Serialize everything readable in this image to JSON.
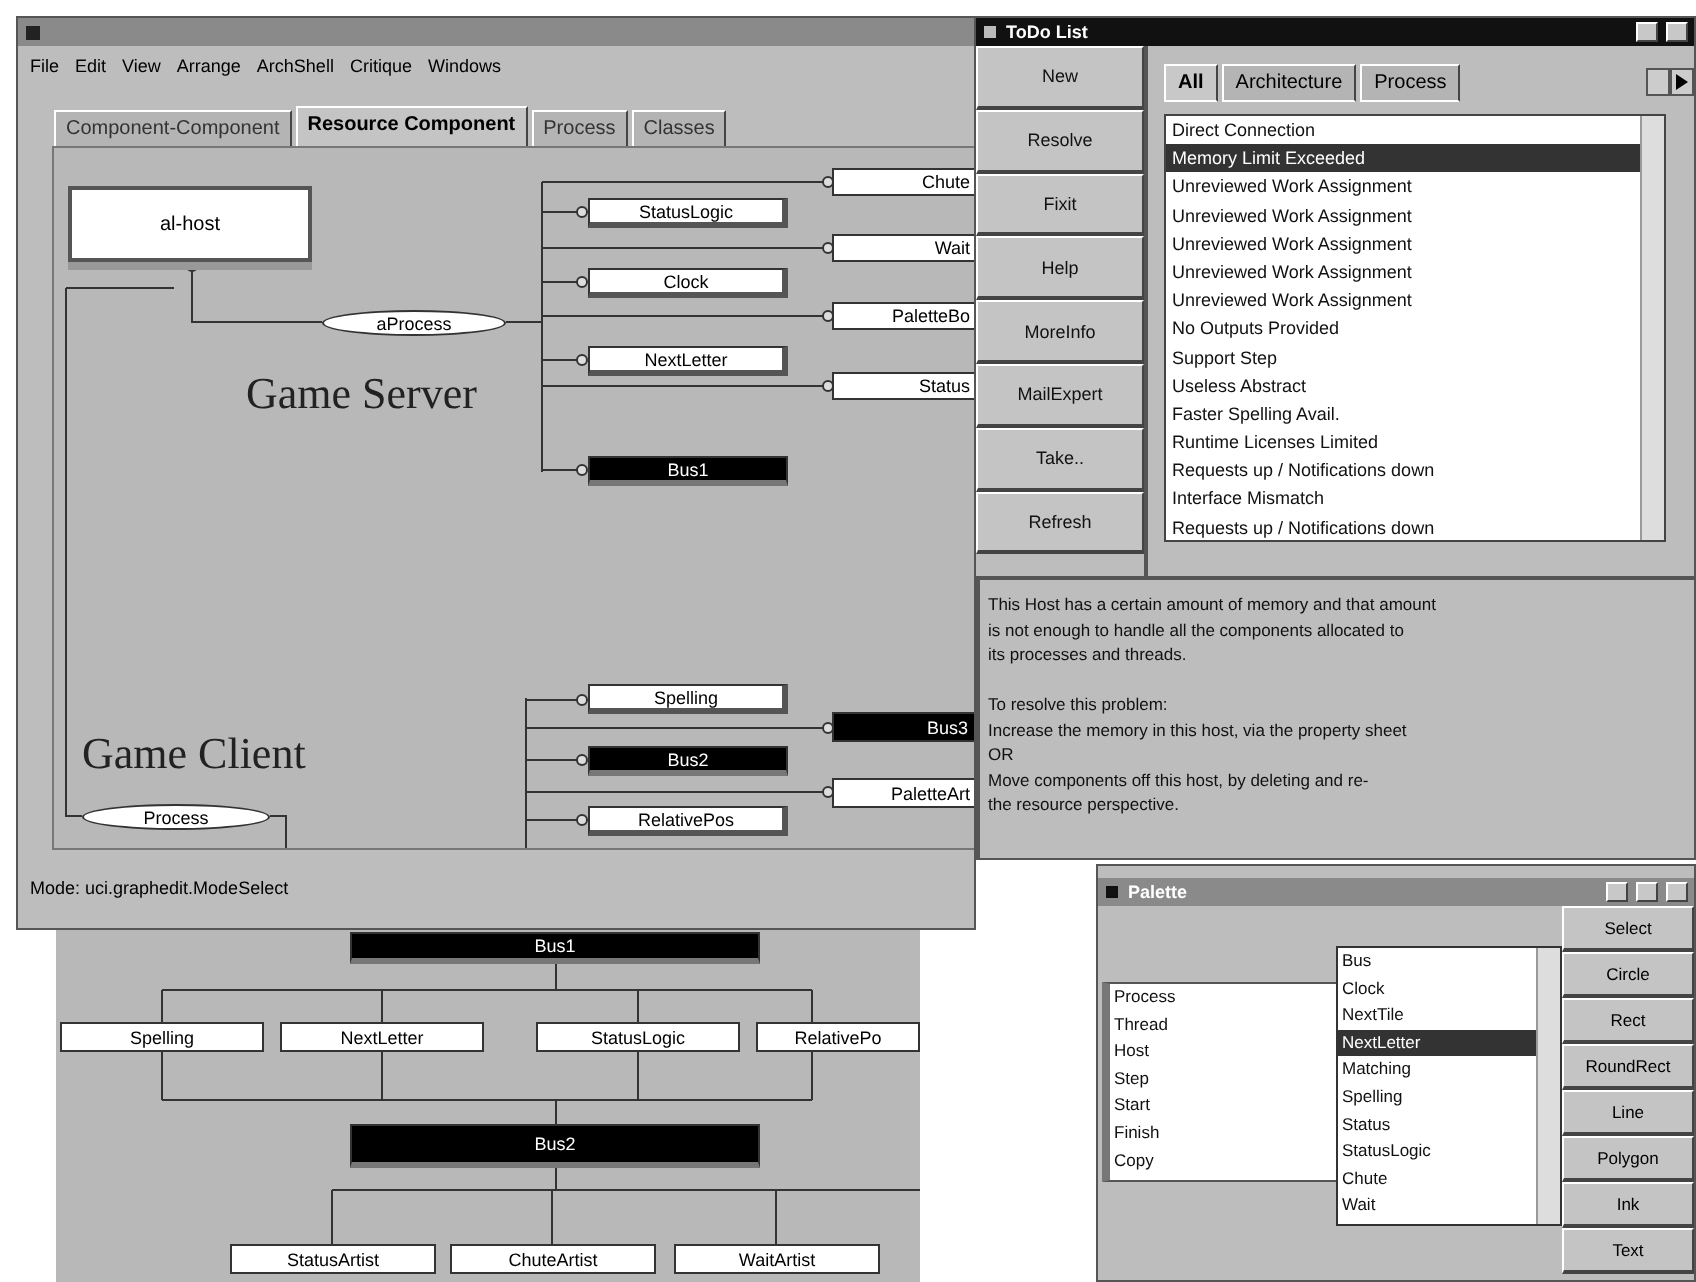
{
  "main_window": {
    "menu": [
      "File",
      "Edit",
      "View",
      "Arrange",
      "ArchShell",
      "Critique",
      "Windows"
    ],
    "tabs": [
      {
        "label": "Component-Component",
        "selected": false
      },
      {
        "label": "Resource Component",
        "selected": true
      },
      {
        "label": "Process",
        "selected": false
      },
      {
        "label": "Classes",
        "selected": false
      }
    ],
    "diagram": {
      "labels": [
        "Game Server",
        "Game Client"
      ],
      "nodes": [
        {
          "text": "al-host",
          "kind": "host"
        },
        {
          "text": "aProcess",
          "kind": "process"
        },
        {
          "text": "StatusLogic",
          "kind": "component"
        },
        {
          "text": "Clock",
          "kind": "component"
        },
        {
          "text": "NextLetter",
          "kind": "component"
        },
        {
          "text": "Bus1",
          "kind": "bus"
        },
        {
          "text": "Chute",
          "kind": "stub"
        },
        {
          "text": "Wait",
          "kind": "stub"
        },
        {
          "text": "PaletteBo",
          "kind": "stub"
        },
        {
          "text": "Status",
          "kind": "stub"
        },
        {
          "text": "Spelling",
          "kind": "component"
        },
        {
          "text": "Bus2",
          "kind": "bus"
        },
        {
          "text": "RelativePos",
          "kind": "component"
        },
        {
          "text": "Bus3",
          "kind": "busstub"
        },
        {
          "text": "PaletteArt",
          "kind": "stub"
        },
        {
          "text": "Process",
          "kind": "process"
        }
      ]
    },
    "status_bar": "Mode: uci.graphedit.ModeSelect"
  },
  "back_window": {
    "nodes": [
      {
        "text": "Bus1",
        "kind": "bus"
      },
      {
        "text": "Spelling",
        "kind": "box"
      },
      {
        "text": "NextLetter",
        "kind": "box"
      },
      {
        "text": "StatusLogic",
        "kind": "box"
      },
      {
        "text": "RelativePo",
        "kind": "box"
      },
      {
        "text": "Bus2",
        "kind": "bus"
      },
      {
        "text": "StatusArtist",
        "kind": "box"
      },
      {
        "text": "ChuteArtist",
        "kind": "box"
      },
      {
        "text": "WaitArtist",
        "kind": "box"
      }
    ]
  },
  "todo_window": {
    "title": "ToDo List",
    "buttons": [
      "New",
      "Resolve",
      "Fixit",
      "Help",
      "MoreInfo",
      "MailExpert",
      "Take..",
      "Refresh"
    ],
    "tabs": [
      {
        "label": "All",
        "selected": true
      },
      {
        "label": "Architecture",
        "selected": false
      },
      {
        "label": "Process",
        "selected": false
      }
    ],
    "items": [
      {
        "text": "Direct Connection",
        "selected": false
      },
      {
        "text": "Memory Limit Exceeded",
        "selected": true
      },
      {
        "text": "Unreviewed Work Assignment",
        "selected": false
      },
      {
        "text": "Unreviewed Work Assignment",
        "selected": false
      },
      {
        "text": "Unreviewed Work Assignment",
        "selected": false
      },
      {
        "text": "Unreviewed Work Assignment",
        "selected": false
      },
      {
        "text": "Unreviewed Work Assignment",
        "selected": false
      },
      {
        "text": "No Outputs Provided",
        "selected": false
      },
      {
        "text": "Support Step",
        "selected": false
      },
      {
        "text": "Useless Abstract",
        "selected": false
      },
      {
        "text": "Faster Spelling Avail.",
        "selected": false
      },
      {
        "text": "Runtime Licenses Limited",
        "selected": false
      },
      {
        "text": "Requests up / Notifications down",
        "selected": false
      },
      {
        "text": "Interface Mismatch",
        "selected": false
      },
      {
        "text": "Requests up / Notifications down",
        "selected": false
      }
    ],
    "description": [
      [
        "This Host has a certain amount of memory and that amount",
        "is not enough to handle all the components allocated to",
        "its processes and threads."
      ],
      [
        "To resolve this problem:",
        "Increase the memory in this host, via the property sheet",
        "OR",
        "Move components off this host, by deleting and re-",
        "the resource perspective."
      ]
    ]
  },
  "palette_window": {
    "title": "Palette",
    "left_list": [
      "Process",
      "Thread",
      "Host",
      "Step",
      "Start",
      "Finish",
      "Copy"
    ],
    "right_list": [
      {
        "text": "Bus",
        "selected": false
      },
      {
        "text": "Clock",
        "selected": false
      },
      {
        "text": "NextTile",
        "selected": false
      },
      {
        "text": "NextLetter",
        "selected": true
      },
      {
        "text": "Matching",
        "selected": false
      },
      {
        "text": "Spelling",
        "selected": false
      },
      {
        "text": "Status",
        "selected": false
      },
      {
        "text": "StatusLogic",
        "selected": false
      },
      {
        "text": "Chute",
        "selected": false
      },
      {
        "text": "Wait",
        "selected": false
      }
    ],
    "buttons": [
      "Select",
      "Circle",
      "Rect",
      "RoundRect",
      "Line",
      "Polygon",
      "Ink",
      "Text"
    ]
  }
}
